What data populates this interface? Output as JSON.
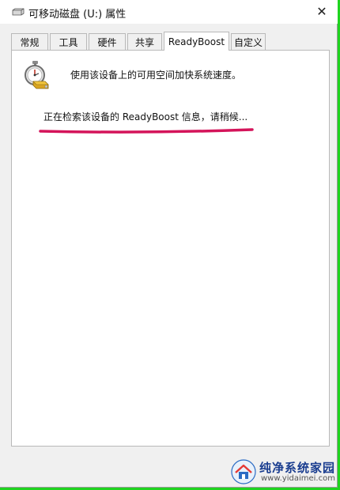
{
  "window": {
    "title": "可移动磁盘 (U:) 属性",
    "close_glyph": "✕"
  },
  "tabs": [
    {
      "label": "常规",
      "active": false
    },
    {
      "label": "工具",
      "active": false
    },
    {
      "label": "硬件",
      "active": false
    },
    {
      "label": "共享",
      "active": false
    },
    {
      "label": "ReadyBoost",
      "active": true
    },
    {
      "label": "自定义",
      "active": false
    }
  ],
  "readyboost": {
    "icon": "readyboost-stopwatch-icon",
    "description": "使用该设备上的可用空间加快系统速度。",
    "status": "正在检索该设备的 ReadyBoost 信息，请稍候...",
    "annotation_color": "#d4145a"
  },
  "watermark": {
    "name": "纯净系统家园",
    "url": "www.yidaimei.com",
    "icon": "house-logo-icon"
  }
}
